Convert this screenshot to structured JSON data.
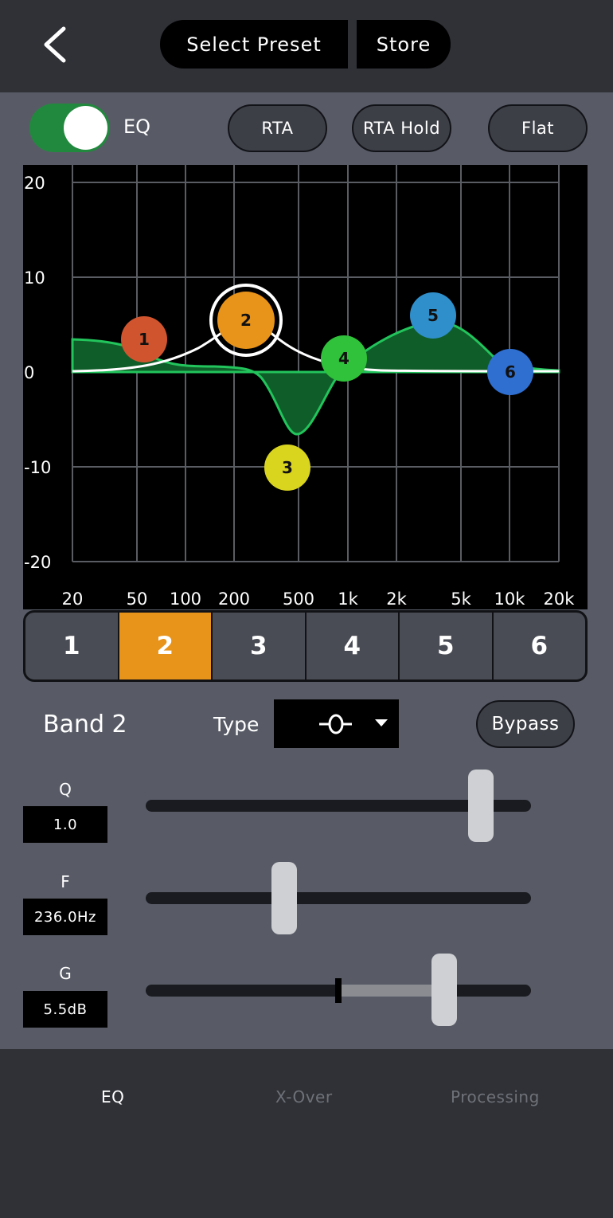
{
  "header": {
    "back_icon": "chevron-left-icon",
    "select_preset_label": "Select Preset",
    "store_label": "Store"
  },
  "eq_toggle": {
    "label": "EQ",
    "on": true
  },
  "buttons": {
    "rta": "RTA",
    "rta_hold": "RTA Hold",
    "flat": "Flat"
  },
  "graph": {
    "y_ticks": [
      "20",
      "10",
      "0",
      "-10",
      "-20"
    ],
    "x_ticks": [
      "20",
      "50",
      "100",
      "200",
      "500",
      "1k",
      "2k",
      "5k",
      "10k",
      "20k"
    ],
    "band_nodes": [
      {
        "label": "1",
        "color": "#d0552f",
        "selected": false
      },
      {
        "label": "2",
        "color": "#e8931a",
        "selected": true
      },
      {
        "label": "3",
        "color": "#d9d41e",
        "selected": false
      },
      {
        "label": "4",
        "color": "#2fc23a",
        "selected": false
      },
      {
        "label": "5",
        "color": "#2f8fcb",
        "selected": false
      },
      {
        "label": "6",
        "color": "#2f6fd0",
        "selected": false
      }
    ]
  },
  "bands": [
    "1",
    "2",
    "3",
    "4",
    "5",
    "6"
  ],
  "active_band_color": "#e8931a",
  "band_editor": {
    "title": "Band 2",
    "type_label": "Type",
    "type_icon": "peaking-filter-icon",
    "bypass_label": "Bypass"
  },
  "params": {
    "q": {
      "label": "Q",
      "value": "1.0",
      "slider_fraction": 0.87
    },
    "f": {
      "label": "F",
      "value": "236.0Hz",
      "slider_fraction": 0.36
    },
    "g": {
      "label": "G",
      "value": "5.5dB",
      "slider_fraction": 0.77
    }
  },
  "tabs": [
    {
      "label": "EQ",
      "active": true
    },
    {
      "label": "X-Over",
      "active": false
    },
    {
      "label": "Processing",
      "active": false
    }
  ]
}
